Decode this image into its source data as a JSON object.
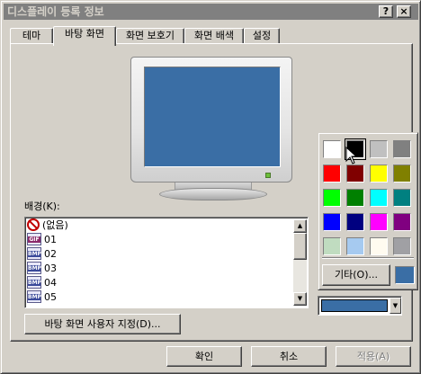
{
  "window": {
    "title": "디스플레이 등록 정보",
    "help_button": "?",
    "close_button": "×"
  },
  "tabs": [
    {
      "label": "테마"
    },
    {
      "label": "바탕 화면"
    },
    {
      "label": "화면 보호기"
    },
    {
      "label": "화면 배색"
    },
    {
      "label": "설정"
    }
  ],
  "background": {
    "label": "배경(K):",
    "items": [
      {
        "label": "(없음)",
        "icon": "none-icon"
      },
      {
        "label": "01",
        "icon": "gif-file-icon"
      },
      {
        "label": "02",
        "icon": "bmp-file-icon"
      },
      {
        "label": "03",
        "icon": "bmp-file-icon"
      },
      {
        "label": "04",
        "icon": "bmp-file-icon"
      },
      {
        "label": "05",
        "icon": "bmp-file-icon"
      }
    ],
    "selected": "(없음)",
    "gif_badge": "GIF",
    "bmp_badge": "BMP"
  },
  "customize_button": "바탕 화면 사용자 지정(D)...",
  "color_picker": {
    "swatches": [
      "#ffffff",
      "#000000",
      "#c0c0c0",
      "#808080",
      "#ff0000",
      "#800000",
      "#ffff00",
      "#808000",
      "#00ff00",
      "#008000",
      "#00ffff",
      "#008080",
      "#0000ff",
      "#000080",
      "#ff00ff",
      "#800080",
      "#c0dcc0",
      "#a6caf0",
      "#fffbf0",
      "#a0a0a4"
    ],
    "selected_swatch": "#000000",
    "other_button": "기타(O)...",
    "current_color": "#3a6ea5"
  },
  "footer": {
    "ok": "확인",
    "cancel": "취소",
    "apply": "적용(A)"
  }
}
